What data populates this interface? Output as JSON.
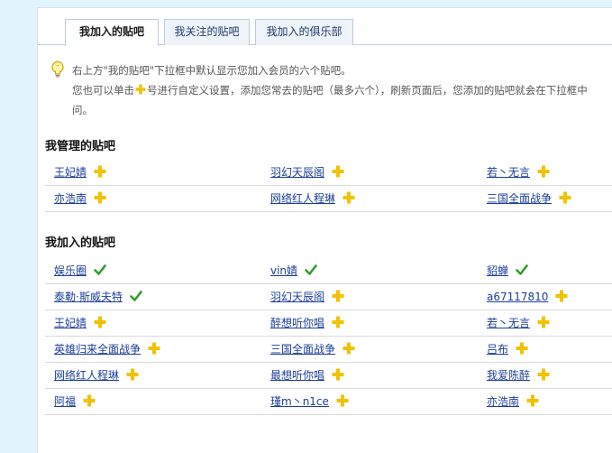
{
  "tabs": [
    {
      "label": "我加入的贴吧",
      "active": true
    },
    {
      "label": "我关注的贴吧",
      "active": false
    },
    {
      "label": "我加入的俱乐部",
      "active": false
    }
  ],
  "tip": {
    "line1": "右上方\"我的贴吧\"下拉框中默认显示您加入会员的六个贴吧。",
    "line2_before": "您也可以单击",
    "line2_after": "号进行自定义设置，添加您常去的贴吧（最多六个），刷新页面后，您添加的贴吧就会在下拉框中",
    "line3": "问。"
  },
  "colors": {
    "plus": "#f2c200",
    "check": "#2e9e2e",
    "link": "#1a3f9b"
  },
  "managed": {
    "title": "我管理的贴吧",
    "rows": [
      [
        {
          "name": "王妃婧",
          "icon": "plus-icon"
        },
        {
          "name": "羽幻天辰阁",
          "icon": "plus-icon"
        },
        {
          "name": "若丶无言",
          "icon": "plus-icon"
        }
      ],
      [
        {
          "name": "亦浩南",
          "icon": "plus-icon"
        },
        {
          "name": "网络红人程琳",
          "icon": "plus-icon"
        },
        {
          "name": "三国全面战争",
          "icon": "plus-icon"
        }
      ]
    ]
  },
  "joined": {
    "title": "我加入的贴吧",
    "rows": [
      [
        {
          "name": "娱乐圈",
          "icon": "check-icon"
        },
        {
          "name": "vin婧",
          "icon": "check-icon"
        },
        {
          "name": "貂蝉",
          "icon": "check-icon"
        }
      ],
      [
        {
          "name": "泰勒·斯威夫特",
          "icon": "check-icon"
        },
        {
          "name": "羽幻天辰阁",
          "icon": "plus-icon"
        },
        {
          "name": "a67117810",
          "icon": "plus-icon"
        }
      ],
      [
        {
          "name": "王妃婧",
          "icon": "plus-icon"
        },
        {
          "name": "醉想听你唱",
          "icon": "plus-icon"
        },
        {
          "name": "若丶无言",
          "icon": "plus-icon"
        }
      ],
      [
        {
          "name": "英雄归来全面战争",
          "icon": "plus-icon"
        },
        {
          "name": "三国全面战争",
          "icon": "plus-icon"
        },
        {
          "name": "吕布",
          "icon": "plus-icon"
        }
      ],
      [
        {
          "name": "网络红人程琳",
          "icon": "plus-icon"
        },
        {
          "name": "最想听你唱",
          "icon": "plus-icon"
        },
        {
          "name": "我爱陈醉",
          "icon": "plus-icon"
        }
      ],
      [
        {
          "name": "阿福",
          "icon": "plus-icon"
        },
        {
          "name": "瑾m丶n1ce",
          "icon": "plus-icon"
        },
        {
          "name": "亦浩南",
          "icon": "plus-icon"
        }
      ]
    ]
  }
}
